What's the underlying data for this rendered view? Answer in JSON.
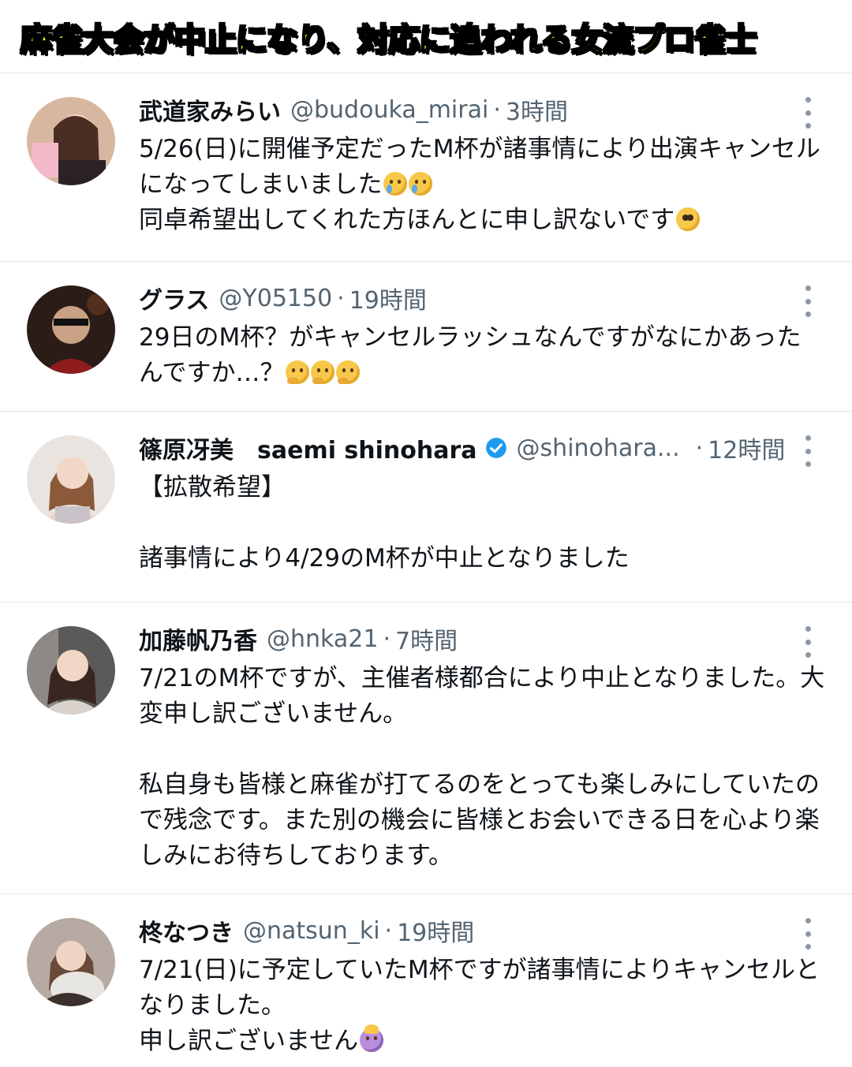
{
  "banner": {
    "title": "麻雀大会が中止になり、対応に追われる女流プロ雀士"
  },
  "tweets": [
    {
      "name": "武道家みらい",
      "handle": "@budouka_mirai",
      "separator": "·",
      "time": "3時間",
      "verified": false,
      "lines": [
        {
          "text": "5/26(日)に開催予定だったM杯が諸事情により出演キャンセル",
          "emojis": []
        },
        {
          "text": "になってしまいました",
          "emojis": [
            "crying-face-emoji",
            "crying-face-emoji"
          ]
        },
        {
          "text": "同卓希望出してくれた方ほんとに申し訳ないです",
          "emojis": [
            "pleading-face-emoji"
          ]
        }
      ]
    },
    {
      "name": "グラス",
      "handle": "@Y05150",
      "separator": "·",
      "time": "19時間",
      "verified": false,
      "lines": [
        {
          "text": "29日のM杯？がキャンセルラッシュなんですがなにかあった",
          "emojis": []
        },
        {
          "text": "んですか…？",
          "emojis": [
            "thinking-face-emoji",
            "thinking-face-emoji",
            "thinking-face-emoji"
          ]
        }
      ]
    },
    {
      "name": "篠原冴美　saemi shinohara",
      "handle": "@shinohara...",
      "separator": "·",
      "time": "12時間",
      "verified": true,
      "lines": [
        {
          "text": "【拡散希望】",
          "emojis": []
        },
        {
          "text": "",
          "emojis": []
        },
        {
          "text": "諸事情により4/29のM杯が中止となりました",
          "emojis": []
        }
      ]
    },
    {
      "name": "加藤帆乃香",
      "handle": "@hnka21",
      "separator": "·",
      "time": "7時間",
      "verified": false,
      "lines": [
        {
          "text": "7/21のM杯ですが、主催者様都合により中止となりました。大",
          "emojis": []
        },
        {
          "text": "変申し訳ございません。",
          "emojis": []
        },
        {
          "text": "",
          "emojis": []
        },
        {
          "text": "私自身も皆様と麻雀が打てるのをとっても楽しみにしていたの",
          "emojis": []
        },
        {
          "text": "で残念です。また別の機会に皆様とお会いできる日を心より楽",
          "emojis": []
        },
        {
          "text": "しみにお待ちしております。",
          "emojis": []
        }
      ]
    },
    {
      "name": "柊なつき",
      "handle": "@natsun_ki",
      "separator": "·",
      "time": "19時間",
      "verified": false,
      "lines": [
        {
          "text": "7/21(日)に予定していたM杯ですが諸事情によりキャンセルと",
          "emojis": []
        },
        {
          "text": "なりました。",
          "emojis": []
        },
        {
          "text": "申し訳ございません",
          "emojis": [
            "person-bowing-emoji"
          ]
        }
      ]
    }
  ]
}
